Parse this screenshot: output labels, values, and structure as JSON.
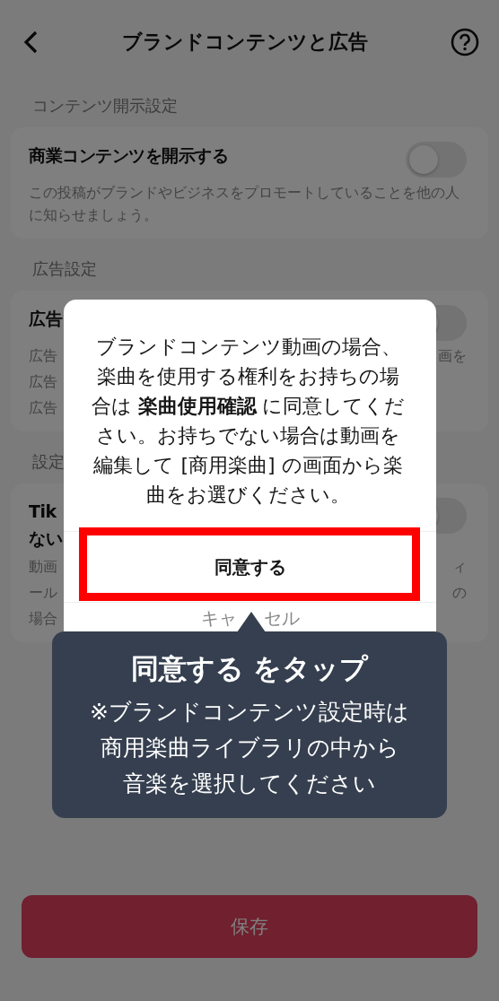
{
  "header": {
    "title": "ブランドコンテンツと広告"
  },
  "sections": [
    {
      "label": "コンテンツ開示設定",
      "toggle_on": false,
      "title_rows": [
        {
          "left": "商業コンテンツを開示する"
        }
      ],
      "desc_rows": [
        {
          "left": "この投稿がブランドやビジネスをプロモートしていることを他の人に知らせましょう。"
        }
      ]
    },
    {
      "label": "広告設定",
      "toggle_on": false,
      "title_rows": [
        {
          "left": "広告"
        }
      ],
      "desc_rows": [
        {
          "left": "広告",
          "right": "画を"
        },
        {
          "left": "広告"
        },
        {
          "left": "広告"
        }
      ]
    },
    {
      "label": "設定",
      "toggle_on": false,
      "title_rows": [
        {
          "left": "Tik"
        },
        {
          "left": "ない"
        }
      ],
      "desc_rows": [
        {
          "left": "動画",
          "right": "ィ"
        },
        {
          "left": "ール",
          "right": "の"
        },
        {
          "left": "場合"
        }
      ]
    }
  ],
  "save_button": {
    "label": "保存",
    "disabled": true
  },
  "dialog": {
    "message": "ブランドコンテンツ動画の場合、楽曲を使用する権利をお持ちの場合は **楽曲使用確認** に同意してください。お持ちでない場合は動画を編集して [商用楽曲] の画面から楽曲をお選びください。",
    "agree_label": "同意する",
    "cancel_label_parts": [
      "キャ",
      "セル"
    ]
  },
  "tooltip": {
    "title": "同意する をタップ",
    "body_lines": [
      "※ブランドコンテンツ設定時は",
      "商用楽曲ライブラリの中から",
      "音楽を選択してください"
    ]
  }
}
